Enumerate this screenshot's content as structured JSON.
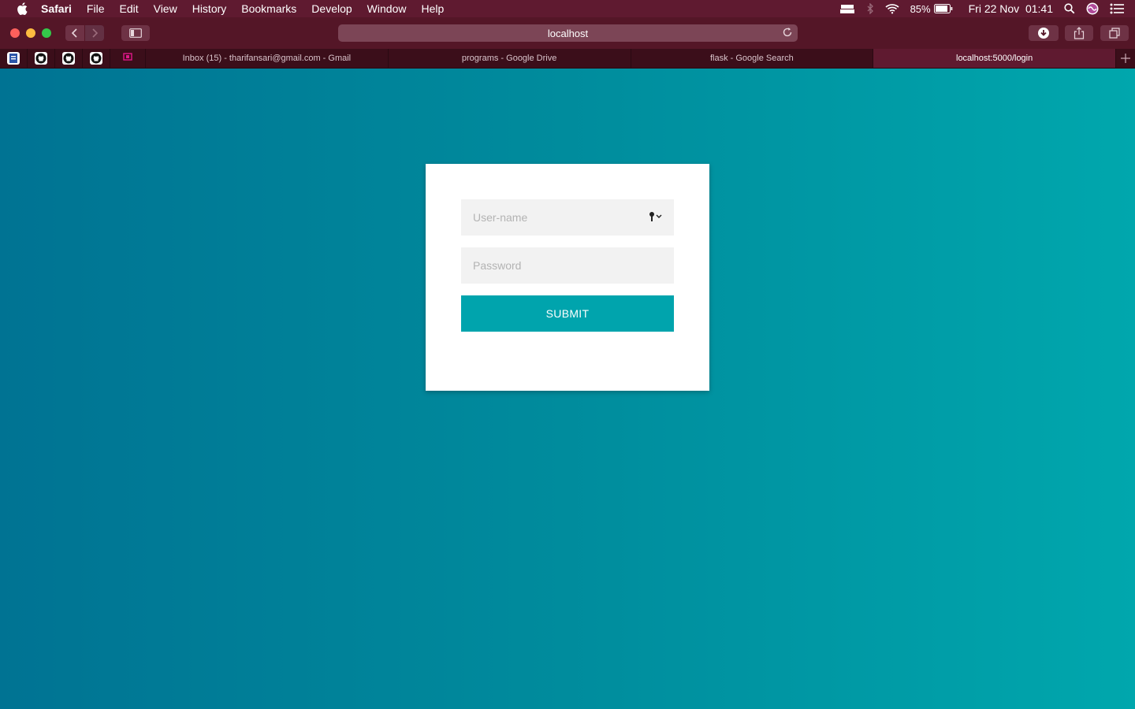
{
  "menubar": {
    "app_name": "Safari",
    "items": [
      "File",
      "Edit",
      "View",
      "History",
      "Bookmarks",
      "Develop",
      "Window",
      "Help"
    ],
    "battery_percent": "85%",
    "datetime": "Fri 22 Nov  01:41"
  },
  "toolbar": {
    "address": "localhost"
  },
  "tabs": {
    "items": [
      {
        "title": "Inbox (15) - tharifansari@gmail.com - Gmail"
      },
      {
        "title": "programs - Google Drive"
      },
      {
        "title": "flask - Google Search"
      },
      {
        "title": "localhost:5000/login"
      }
    ]
  },
  "login": {
    "username_placeholder": "User-name",
    "password_placeholder": "Password",
    "submit_label": "SUBMIT"
  },
  "colors": {
    "menubar_bg": "#5f1a30",
    "page_gradient_start": "#007393",
    "page_gradient_end": "#00a7ad",
    "submit_bg": "#00a4ad"
  }
}
